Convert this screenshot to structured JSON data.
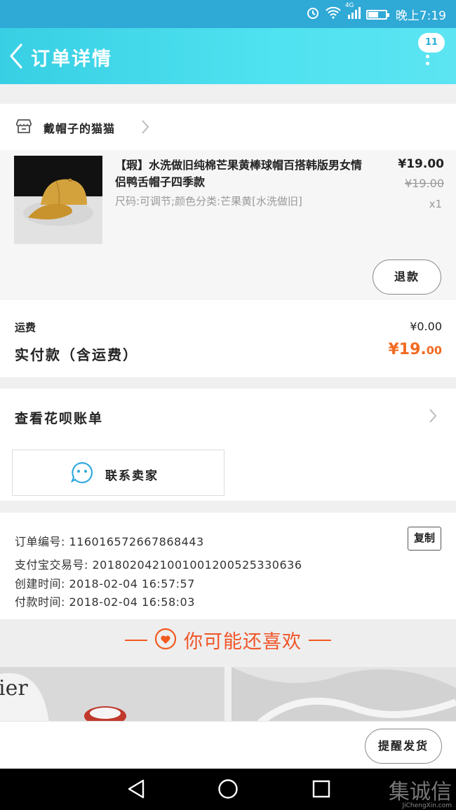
{
  "status_bar": {
    "network_label": "4G",
    "time": "晚上7:19",
    "battery_level": 0.55
  },
  "header": {
    "title": "订单详情",
    "message_count": "11"
  },
  "shop": {
    "name": "戴帽子的猫猫"
  },
  "product": {
    "title": "【瑕】水洗做旧纯棉芒果黄棒球帽百搭韩版男女情侣鸭舌帽子四季款",
    "spec": "尺码:可调节;颜色分类:芒果黄[水洗做旧]",
    "price": "¥19.00",
    "original_price": "¥19.00",
    "quantity": "x1",
    "refund_label": "退款"
  },
  "totals": {
    "shipping_label": "运费",
    "shipping_value": "¥0.00",
    "paid_label": "实付款（含运费）",
    "paid_main": "¥19.",
    "paid_decimal": "00"
  },
  "huabei": {
    "label": "查看花呗账单"
  },
  "contact": {
    "label": "联系卖家"
  },
  "order_info": {
    "order_no": "订单编号: 116016572667868443",
    "alipay_no": "支付宝交易号: 2018020421001001200525330636",
    "created": "创建时间: 2018-02-04 16:57:57",
    "paid": "付款时间: 2018-02-04 16:58:03",
    "copy_label": "复制"
  },
  "recommend": {
    "title": "你可能还喜欢",
    "left_image_text": "ier"
  },
  "actions": {
    "remind_label": "提醒发货"
  },
  "watermark": {
    "text": "集诚信",
    "sub": "JiChengXin.com"
  },
  "colors": {
    "header_start": "#38cfe4",
    "header_end": "#5ce4f2",
    "accent_orange": "#f26b21",
    "status_bar": "#2fa9d6"
  }
}
